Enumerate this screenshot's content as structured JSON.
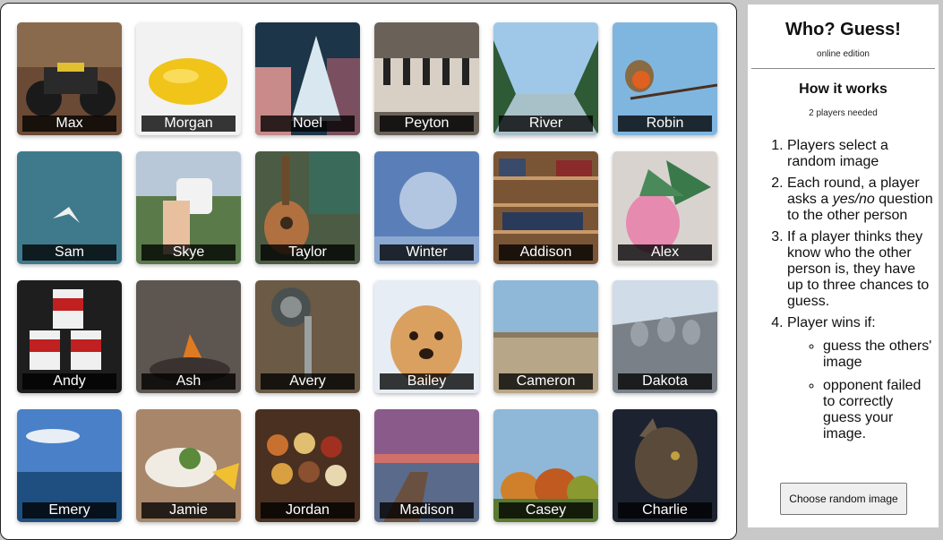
{
  "cards": [
    {
      "name": "Max",
      "bg": "#6b4a35"
    },
    {
      "name": "Morgan",
      "bg": "#eeeeee"
    },
    {
      "name": "Noel",
      "bg": "#1d3548"
    },
    {
      "name": "Peyton",
      "bg": "#6a6259"
    },
    {
      "name": "River",
      "bg": "#4c7a52"
    },
    {
      "name": "Robin",
      "bg": "#7fb6e0"
    },
    {
      "name": "Sam",
      "bg": "#3f7a8c"
    },
    {
      "name": "Skye",
      "bg": "#6f8a6a"
    },
    {
      "name": "Taylor",
      "bg": "#4c5b43"
    },
    {
      "name": "Winter",
      "bg": "#5a7fb8"
    },
    {
      "name": "Addison",
      "bg": "#7a5535"
    },
    {
      "name": "Alex",
      "bg": "#d9d3cf"
    },
    {
      "name": "Andy",
      "bg": "#2a2a2a"
    },
    {
      "name": "Ash",
      "bg": "#5d5550"
    },
    {
      "name": "Avery",
      "bg": "#6b5a45"
    },
    {
      "name": "Bailey",
      "bg": "#c9925a"
    },
    {
      "name": "Cameron",
      "bg": "#b8a688"
    },
    {
      "name": "Dakota",
      "bg": "#8a949c"
    },
    {
      "name": "Emery",
      "bg": "#3c6ea8"
    },
    {
      "name": "Jamie",
      "bg": "#a8866a"
    },
    {
      "name": "Jordan",
      "bg": "#6a4530"
    },
    {
      "name": "Madison",
      "bg": "#8a5a6a"
    },
    {
      "name": "Casey",
      "bg": "#8fb8d8"
    },
    {
      "name": "Charlie",
      "bg": "#1c2230"
    }
  ],
  "panel": {
    "title": "Who? Guess!",
    "subtitle": "online edition",
    "how_title": "How it works",
    "players": "2 players needed",
    "step1": "Players select a random image",
    "step2_pre": "Each round, a player asks a ",
    "step2_em": "yes/no",
    "step2_post": " question to the other person",
    "step3": "If a player thinks they know who the other person is, they have up to three chances to guess.",
    "step4": "Player wins if:",
    "win1": "guess the others' image",
    "win2": "opponent failed to correctly guess your image.",
    "choose_button": "Choose random image"
  },
  "colors": {
    "page_bg": "#c8c8c8",
    "name_label_bg": "#000000"
  }
}
